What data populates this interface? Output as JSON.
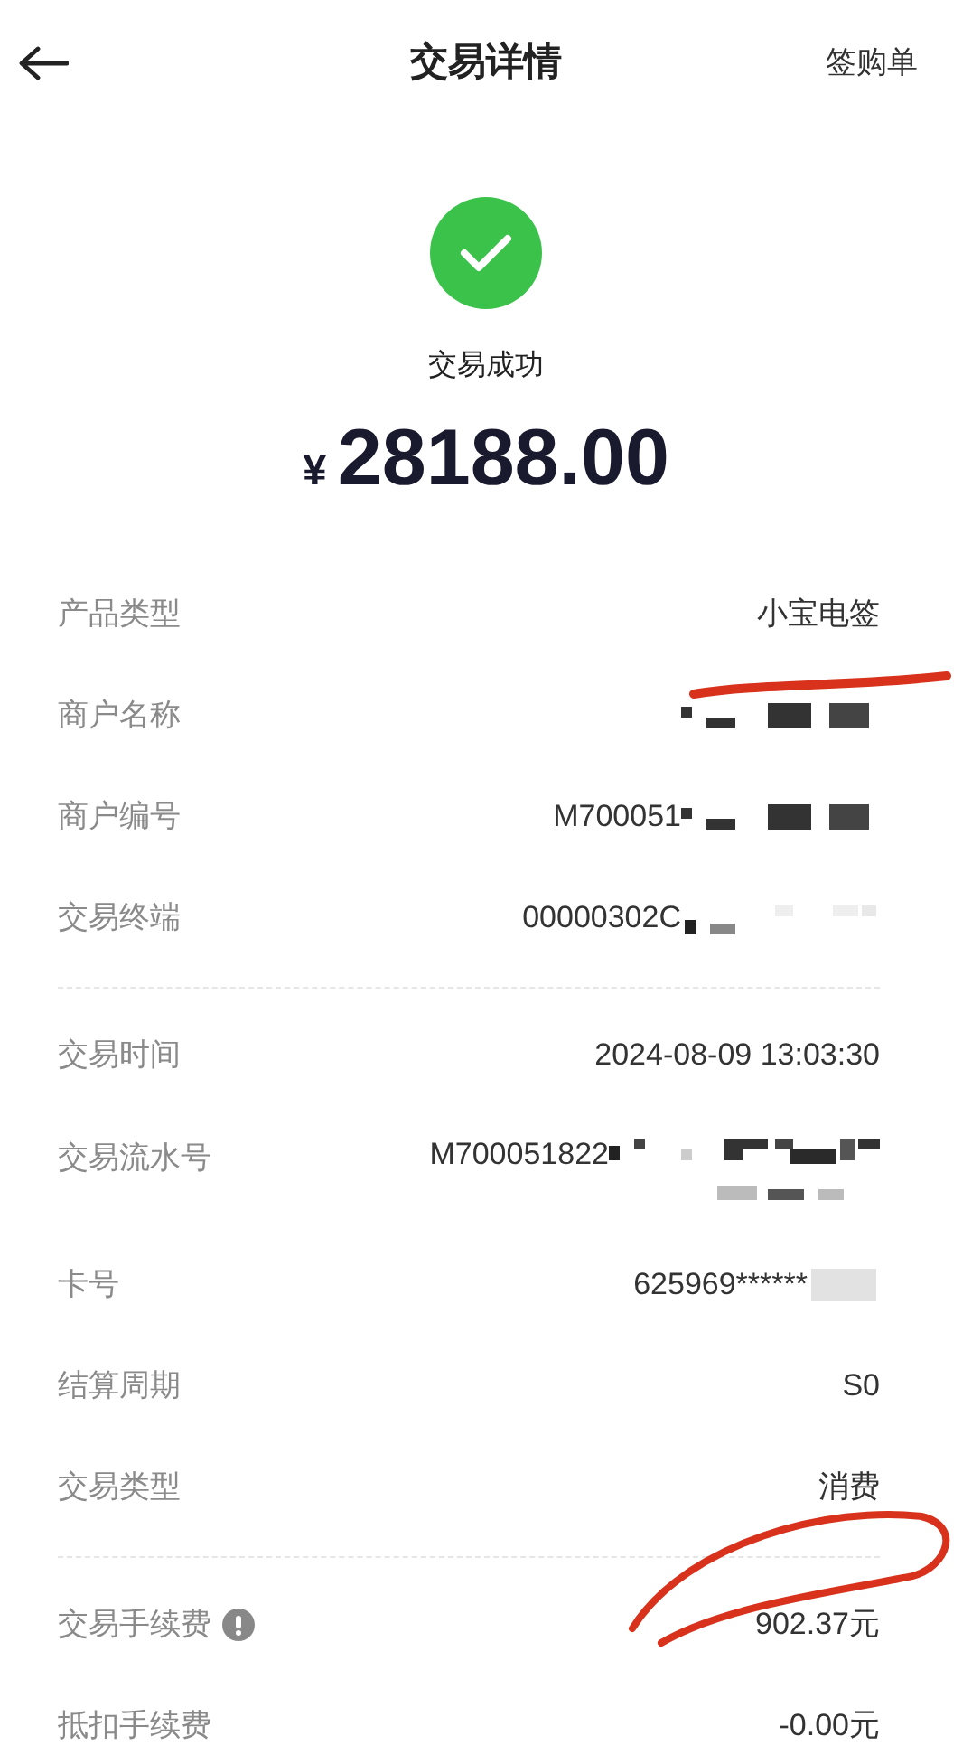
{
  "header": {
    "title": "交易详情",
    "action": "签购单"
  },
  "status": {
    "text": "交易成功",
    "success": true
  },
  "amount": {
    "currency": "¥",
    "value": "28188.00"
  },
  "sections": [
    {
      "rows": [
        {
          "label": "产品类型",
          "value": "小宝电签"
        },
        {
          "label": "商户名称",
          "redacted": true,
          "marked": true
        },
        {
          "label": "商户编号",
          "value": "M700051",
          "redacted": true
        },
        {
          "label": "交易终端",
          "value": "00000302C",
          "redacted": true
        }
      ]
    },
    {
      "rows": [
        {
          "label": "交易时间",
          "value": "2024-08-09 13:03:30"
        },
        {
          "label": "交易流水号",
          "value": "M700051822",
          "redacted": true
        },
        {
          "label": "卡号",
          "value": "625969******",
          "redacted": true
        },
        {
          "label": "结算周期",
          "value": "S0"
        },
        {
          "label": "交易类型",
          "value": "消费"
        }
      ]
    },
    {
      "rows": [
        {
          "label": "交易手续费",
          "value": "902.37元",
          "info": true,
          "marked": true
        },
        {
          "label": "抵扣手续费",
          "value": "-0.00元"
        }
      ]
    }
  ]
}
